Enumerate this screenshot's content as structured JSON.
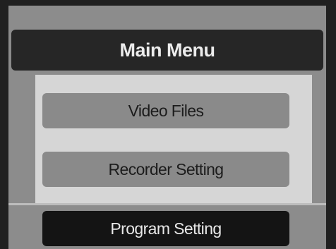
{
  "menu": {
    "title": "Main Menu",
    "items": [
      {
        "label": "Video Files",
        "selected": false
      },
      {
        "label": "Recorder Setting",
        "selected": false
      },
      {
        "label": "Program Setting",
        "selected": true
      }
    ]
  },
  "colors": {
    "panel": "#8c8c8c",
    "title_bar": "#262626",
    "menu_area": "#d6d6d6",
    "button": "#8a8a8a",
    "button_selected": "#141414"
  }
}
